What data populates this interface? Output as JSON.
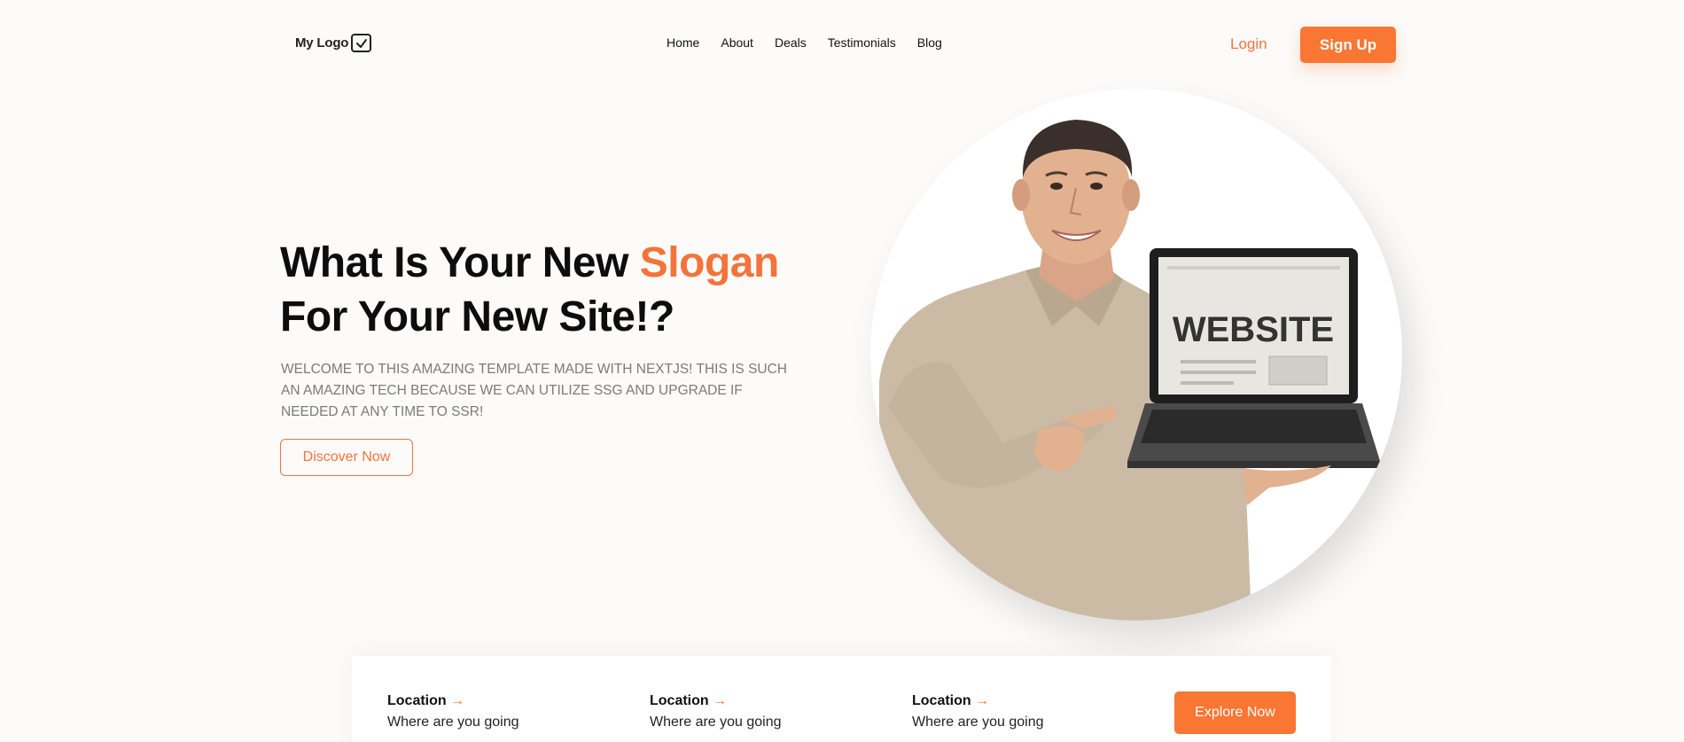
{
  "nav": {
    "logo_text": "My Logo",
    "links": [
      "Home",
      "About",
      "Deals",
      "Testimonials",
      "Blog"
    ],
    "login_label": "Login",
    "signup_label": "Sign Up"
  },
  "hero": {
    "title_part1": "What Is Your New ",
    "title_accent": "Slogan",
    "title_part2": "For Your New Site!?",
    "subtitle": "WELCOME TO THIS AMAZING TEMPLATE MADE WITH NEXTJS! THIS IS SUCH AN AMAZING TECH BECAUSE WE CAN UTILIZE SSG AND UPGRADE IF NEEDED AT ANY TIME TO SSR!",
    "cta_label": "Discover Now",
    "image_screen_text": "WEBSITE"
  },
  "search": {
    "fields": [
      {
        "title": "Location",
        "arrow": "→",
        "placeholder": "Where are you going"
      },
      {
        "title": "Location",
        "arrow": "→",
        "placeholder": "Where are you going"
      },
      {
        "title": "Location",
        "arrow": "→",
        "placeholder": "Where are you going"
      }
    ],
    "explore_label": "Explore Now"
  },
  "colors": {
    "accent": "#f97633",
    "background": "#fcfbfa"
  },
  "icons": {
    "logo_icon": "checkbox-check-icon"
  }
}
